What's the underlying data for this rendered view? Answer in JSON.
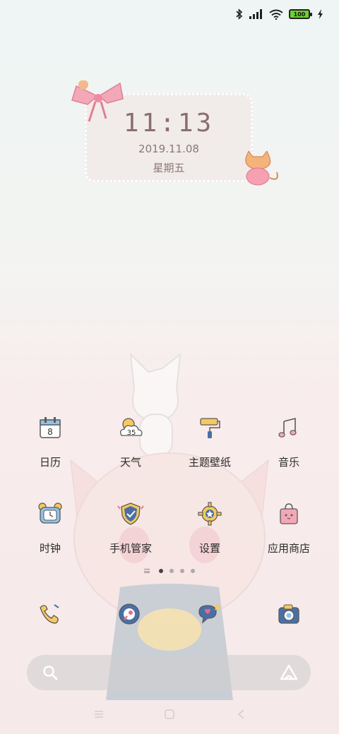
{
  "status_bar": {
    "battery_level": "100",
    "icons": [
      "bluetooth-icon",
      "signal-icon",
      "wifi-icon",
      "battery-icon",
      "charging-icon"
    ]
  },
  "clock_widget": {
    "time": "11:13",
    "date": "2019.11.08",
    "weekday": "星期五"
  },
  "apps": [
    {
      "label": "日历",
      "icon": "calendar-icon",
      "badge": "8"
    },
    {
      "label": "天气",
      "icon": "weather-icon",
      "badge": "35"
    },
    {
      "label": "主题壁纸",
      "icon": "paint-roller-icon"
    },
    {
      "label": "音乐",
      "icon": "music-note-icon"
    },
    {
      "label": "时钟",
      "icon": "alarm-clock-icon"
    },
    {
      "label": "手机管家",
      "icon": "shield-icon"
    },
    {
      "label": "设置",
      "icon": "gear-icon"
    },
    {
      "label": "应用商店",
      "icon": "shopping-bag-icon"
    }
  ],
  "dock": [
    {
      "icon": "phone-icon"
    },
    {
      "icon": "browser-icon"
    },
    {
      "icon": "message-icon"
    },
    {
      "icon": "camera-icon"
    }
  ],
  "page_indicator": {
    "pages": 4,
    "active": 1
  },
  "colors": {
    "accent_pink": "#e96b86",
    "card_bg": "#f1ecea",
    "label_text": "#2b2b2b"
  }
}
